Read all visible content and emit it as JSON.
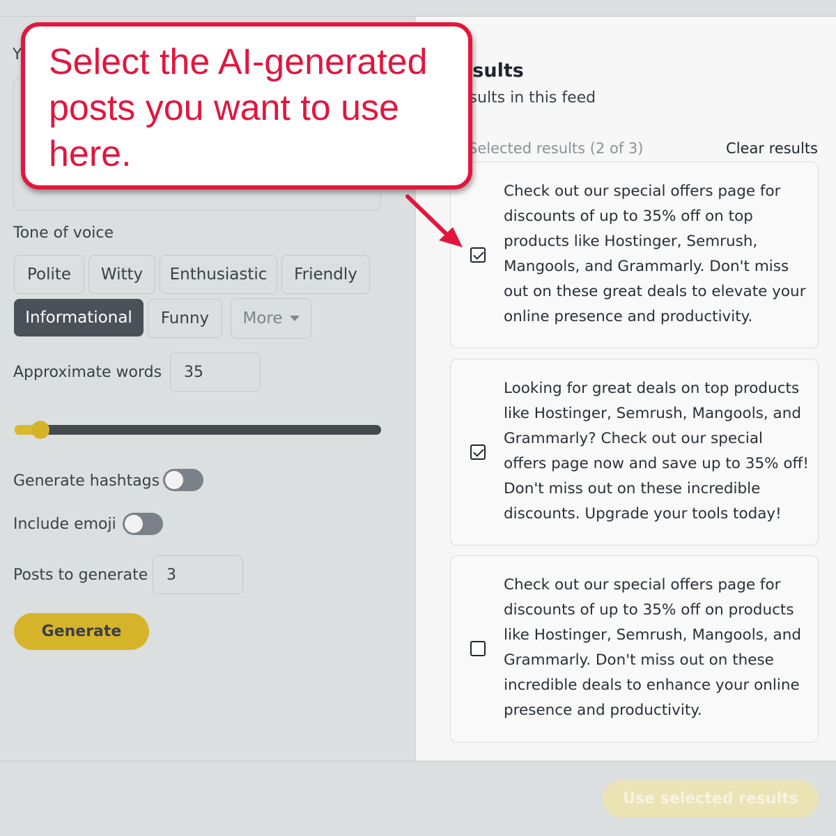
{
  "form": {
    "partial_label": "Y",
    "tone_label": "Tone of voice",
    "tones": [
      "Polite",
      "Witty",
      "Enthusiastic",
      "Friendly",
      "Informational",
      "Funny"
    ],
    "active_tone": "Informational",
    "more_label": "More",
    "words_label": "Approximate words",
    "words_value": "35",
    "words_slider_fraction": 0.07,
    "hashtags_label": "Generate hashtags",
    "hashtags_on": false,
    "emoji_label": "Include emoji",
    "emoji_on": false,
    "posts_label": "Posts to generate",
    "posts_value": "3",
    "generate_label": "Generate"
  },
  "results": {
    "title_partial": "esults",
    "subtitle_partial": "esults in this feed",
    "selected_count": "Selected results (2 of 3)",
    "clear_label": "Clear results",
    "items": [
      {
        "text": "Check out our special offers page for discounts of up to 35% off on top products like Hostinger, Semrush, Mangools, and Grammarly. Don't miss out on these great deals to elevate your online presence and productivity.",
        "checked": true
      },
      {
        "text": "Looking for great deals on top products like Hostinger, Semrush, Mangools, and Grammarly? Check out our special offers page now and save up to 35% off! Don't miss out on these incredible discounts. Upgrade your tools today!",
        "checked": true
      },
      {
        "text": "Check out our special offers page for discounts of up to 35% off on products like Hostinger, Semrush, Mangools, and Grammarly. Don't miss out on these incredible deals to enhance your online presence and productivity.",
        "checked": false
      }
    ],
    "use_label": "Use selected results"
  },
  "callout": {
    "text": "Select the AI-generated posts you want to use here.",
    "color": "#e2163d"
  },
  "colors": {
    "accent": "#d6b42a",
    "active_chip": "#4b5159"
  }
}
